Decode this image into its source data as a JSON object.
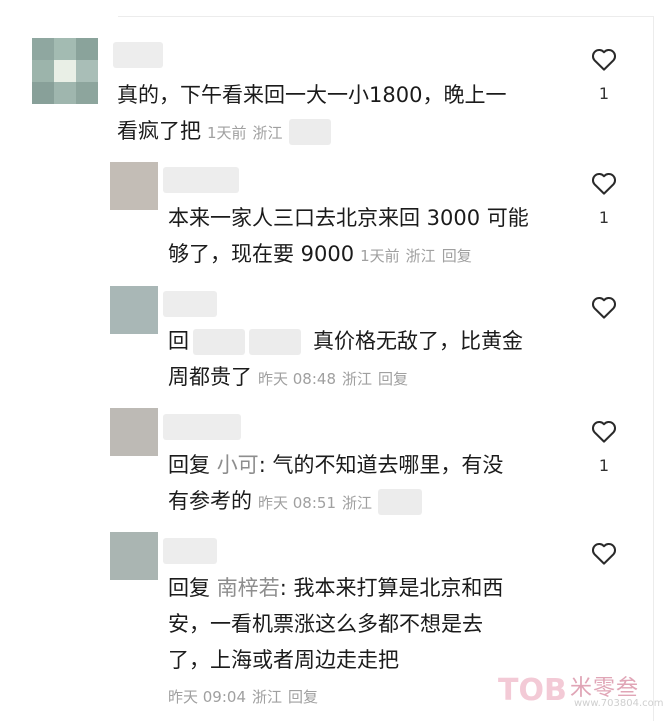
{
  "comments": [
    {
      "line1": "真的，下午看来回一大一小1800，晚上一",
      "line2": "看疯了把",
      "time": "1天前",
      "location": "浙江",
      "likes": "1"
    },
    {
      "line1": "本来一家人三口去北京来回 3000 可能",
      "line2": "够了，现在要 9000",
      "time": "1天前",
      "location": "浙江",
      "reply": "回复",
      "likes": "1"
    },
    {
      "line1_prefix": "回",
      "line1_suffix": "真价格无敌了，比黄金",
      "line2": "周都贵了",
      "time": "昨天 08:48",
      "location": "浙江",
      "reply": "回复",
      "likes": ""
    },
    {
      "prefix": "回复",
      "mention": "小可",
      "line1": ": 气的不知道去哪里，有没",
      "line2": "有参考的",
      "time": "昨天 08:51",
      "location": "浙江",
      "likes": "1"
    },
    {
      "prefix": "回复",
      "mention": "南梓若",
      "line1": ": 我本来打算是北京和西",
      "line2": "安，一看机票涨这么多都不想是去",
      "line3": "了，上海或者周边走走把",
      "time": "昨天 09:04",
      "location": "浙江",
      "reply": "回复",
      "likes": ""
    }
  ],
  "watermark": {
    "logo": "TOB",
    "name": "米零叁",
    "url": "www.703804.com"
  },
  "icons": {
    "like": "heart-outline-icon"
  }
}
